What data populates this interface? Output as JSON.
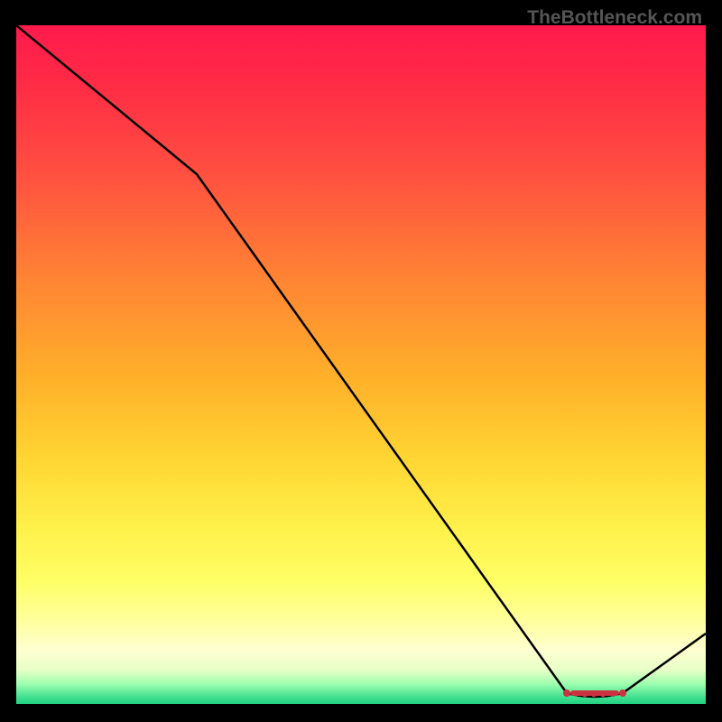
{
  "watermark": "TheBottleneck.com",
  "chart_data": {
    "type": "line",
    "title": "",
    "xlabel": "",
    "ylabel": "",
    "x": [
      0,
      0.26,
      0.8,
      0.88,
      1.0
    ],
    "y": [
      1.0,
      0.78,
      0.0,
      0.0,
      0.1
    ],
    "xlim": [
      0,
      1
    ],
    "ylim": [
      0,
      1
    ],
    "marker_region": {
      "x_start": 0.8,
      "x_end": 0.88,
      "y": 0.0
    },
    "background_gradient": [
      "#ff1a4d",
      "#ffd633",
      "#ffff66",
      "#20d080"
    ]
  }
}
